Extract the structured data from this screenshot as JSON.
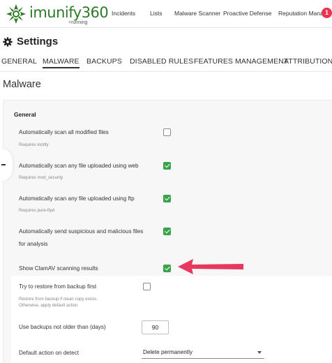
{
  "nav": {
    "brand": "imunify360",
    "brand_sub": "+running",
    "items": [
      "Incidents",
      "Lists",
      "Malware Scanner",
      "Proactive Defense",
      "Reputation Management"
    ],
    "badge": "1"
  },
  "settings_title": "Settings",
  "tabs": [
    "GENERAL",
    "MALWARE",
    "BACKUPS",
    "DISABLED RULES",
    "FEATURES MANAGEMENT",
    "ATTRIBUTIONS"
  ],
  "active_tab": "MALWARE",
  "section_title": "Malware",
  "general": {
    "title": "General",
    "options": [
      {
        "label": "Automatically scan all modified files",
        "sub": "Requires inotify",
        "checked": false
      },
      {
        "label": "Automatically scan any file uploaded using web",
        "sub": "Requires mod_security",
        "checked": true
      },
      {
        "label": "Automatically scan any file uploaded using ftp",
        "sub": "Requires pure-ftpd",
        "checked": true
      },
      {
        "label": "Automatically send suspicious and malicious files",
        "label2": "for analysis",
        "checked": true
      },
      {
        "label": "Show ClamAV scanning results",
        "checked": true
      }
    ]
  },
  "restore": {
    "label": "Try to restore from backup first",
    "sub1": "Restore from backup if clean copy exists.",
    "sub2": "Otherwise, apply default action",
    "checked": false
  },
  "backups_age": {
    "label": "Use backups not older than (days)",
    "value": "90"
  },
  "default_action": {
    "label": "Default action on detect",
    "value": "Delete permanently"
  },
  "colors": {
    "accent_green": "#3aa34a",
    "brand_green": "#2f7a2a",
    "badge_red": "#e8344e",
    "arrow_pink": "#e8385e"
  }
}
